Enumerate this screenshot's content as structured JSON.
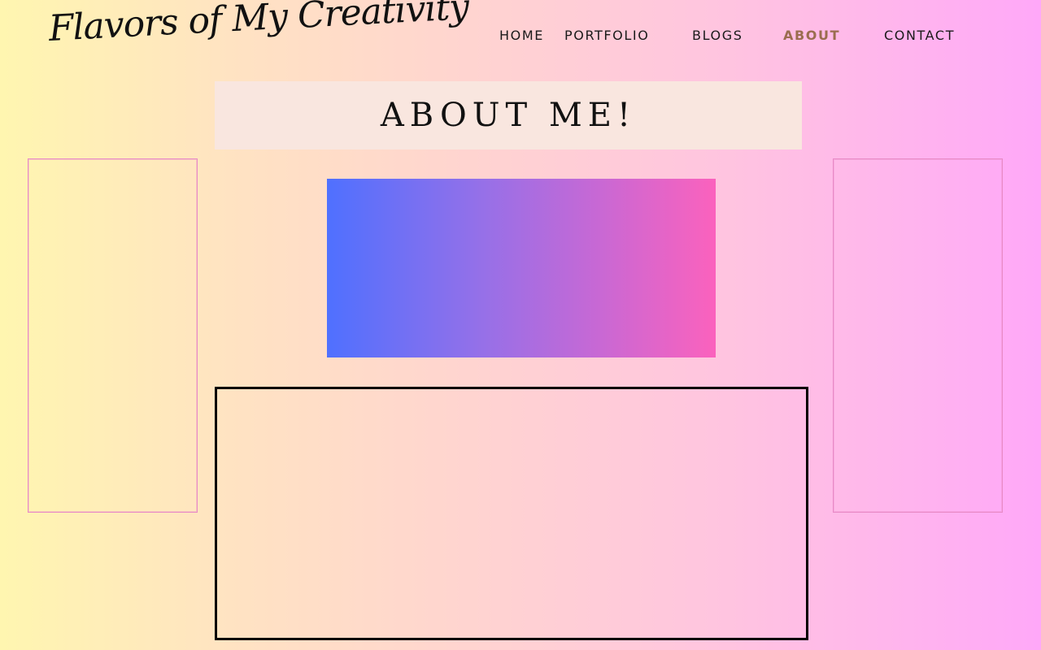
{
  "header": {
    "logo_text": "Flavors of My Creativity"
  },
  "nav": {
    "items": [
      {
        "label": "HOME"
      },
      {
        "label": "PORTFOLIO"
      },
      {
        "label": "BLOGS"
      },
      {
        "label": "ABOUT",
        "active": true
      },
      {
        "label": "CONTACT"
      }
    ],
    "active_color": "#9a6d4f"
  },
  "main": {
    "title": "ABOUT ME!"
  },
  "colors": {
    "background_gradient": [
      "#fff6b0",
      "#ffd4d0",
      "#ffa8f8"
    ],
    "banner_gradient": [
      "#4f70ff",
      "#c868d4",
      "#fb62bd"
    ],
    "title_box_bg": "#f9e6df",
    "panel_border": "#e88ac6"
  }
}
